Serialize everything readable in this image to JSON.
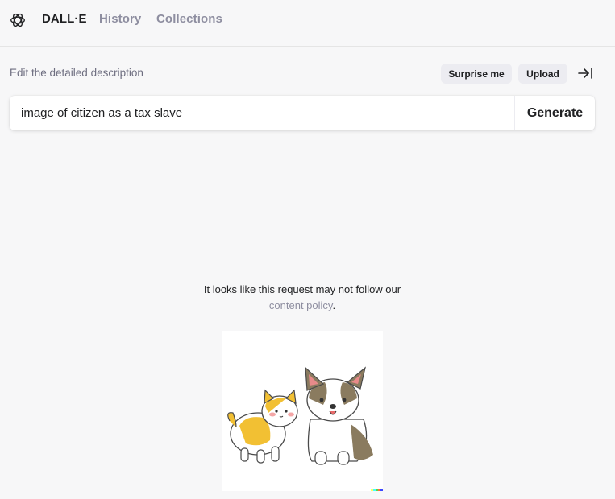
{
  "header": {
    "logo_icon": "openai-logo-icon",
    "nav": [
      {
        "label": "DALL·E",
        "active": true
      },
      {
        "label": "History",
        "active": false
      },
      {
        "label": "Collections",
        "active": false
      }
    ]
  },
  "editor": {
    "hint": "Edit the detailed description",
    "surprise_label": "Surprise me",
    "upload_label": "Upload",
    "collapse_icon": "collapse-sidebar-icon",
    "prompt_value": "image of citizen as a tax slave",
    "generate_label": "Generate"
  },
  "result": {
    "message": "It looks like this request may not follow our",
    "link_text": "content policy",
    "link_suffix": ".",
    "illustration": "cat-and-corgi-illustration"
  },
  "colors": {
    "background": "#f7f7f8",
    "text_primary": "#202123",
    "text_muted": "#8e8ea0",
    "pill_bg": "#ececf1"
  }
}
